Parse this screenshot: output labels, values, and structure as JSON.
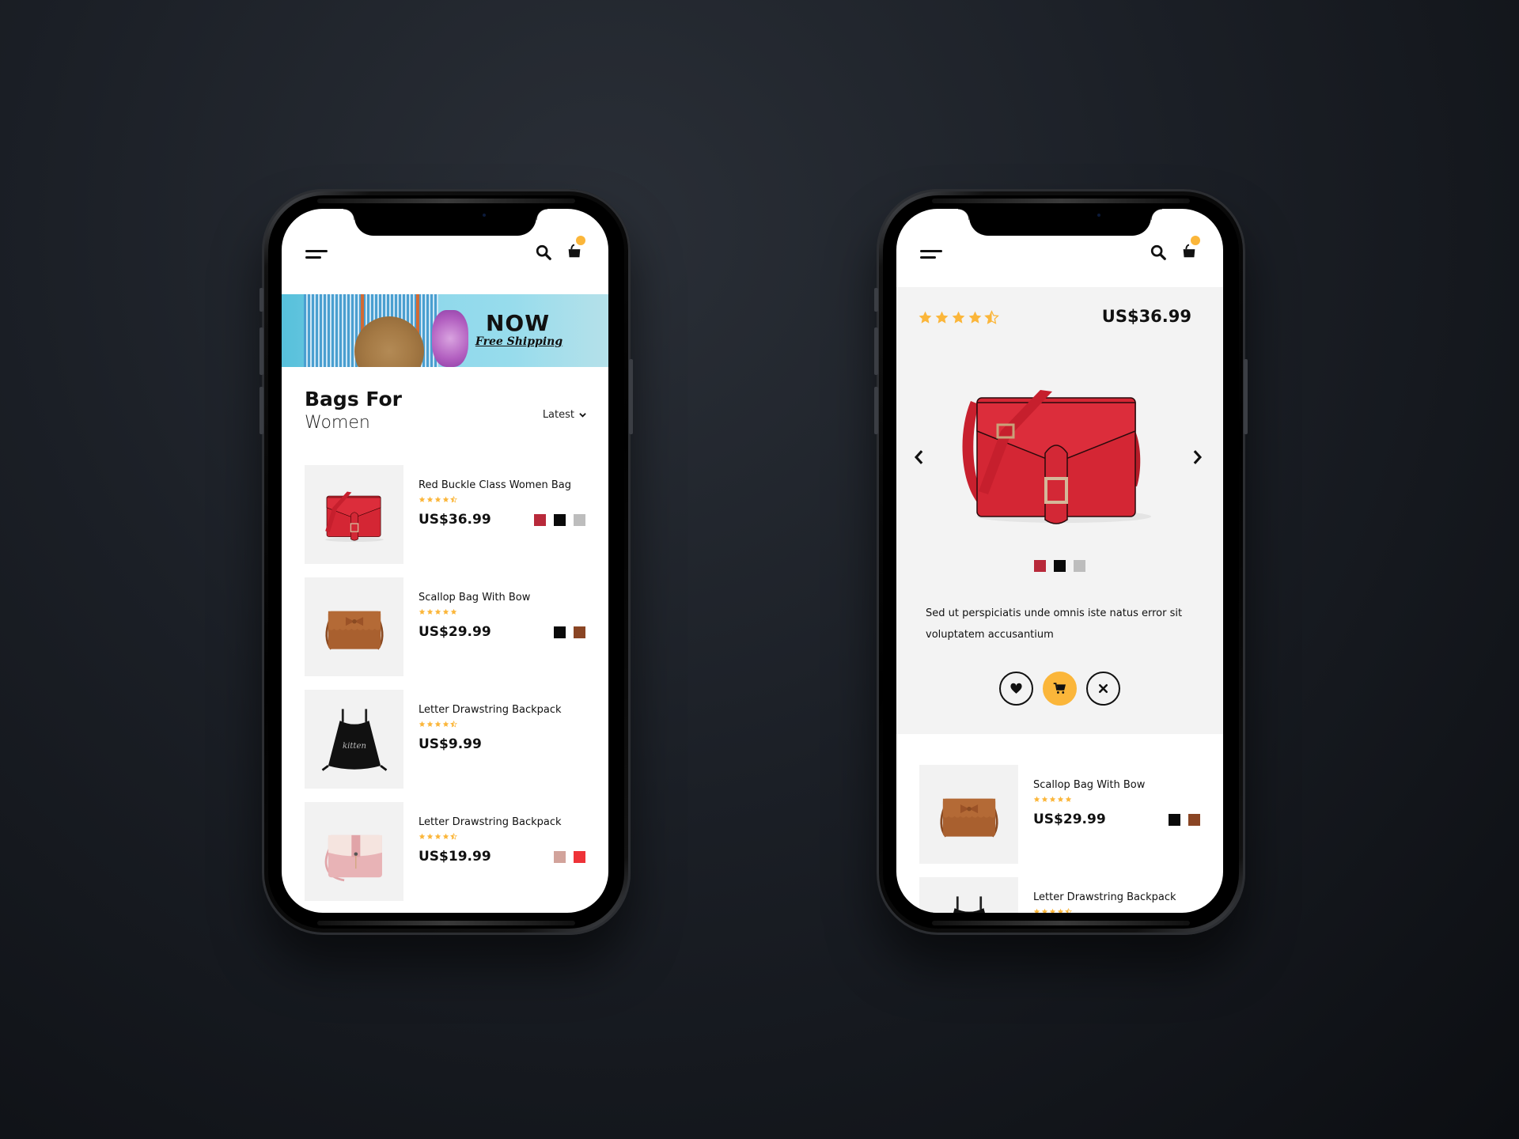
{
  "colors": {
    "accent": "#fbb63a",
    "star": "#fbb63a",
    "text": "#111111",
    "panel": "#f3f3f3"
  },
  "icons": {
    "menu": "hamburger-menu-icon",
    "search": "search-icon",
    "cart": "shopping-bag-icon",
    "prev": "chevron-left-icon",
    "next": "chevron-right-icon",
    "wishlist": "heart-icon",
    "add_to_cart": "cart-icon",
    "dismiss": "close-icon"
  },
  "listing_screen": {
    "banner": {
      "headline": "NOW",
      "subline": "Free Shipping"
    },
    "title_line1": "Bags For",
    "title_line2": "Women",
    "sort": {
      "selected": "Latest"
    },
    "products": [
      {
        "name": "Red Buckle Class Women Bag",
        "rating": 4.5,
        "price": "US$36.99",
        "swatches": [
          "#b8293a",
          "#0a0a0a",
          "#bdbdbd"
        ],
        "image": "red-bag"
      },
      {
        "name": "Scallop Bag With Bow",
        "rating": 5,
        "price": "US$29.99",
        "swatches": [
          "#0a0a0a",
          "#8a4524"
        ],
        "image": "brown-bag"
      },
      {
        "name": "Letter Drawstring Backpack",
        "rating": 4.5,
        "price": "US$9.99",
        "swatches": [],
        "image": "black-backpack"
      },
      {
        "name": "Letter Drawstring Backpack",
        "rating": 4.5,
        "price": "US$19.99",
        "swatches": [
          "#d2a39b",
          "#ee3338"
        ],
        "image": "pink-bag"
      }
    ]
  },
  "detail_screen": {
    "rating": 4.5,
    "price": "US$36.99",
    "swatches": [
      "#b8293a",
      "#0a0a0a",
      "#bdbdbd"
    ],
    "description": "Sed ut perspiciatis unde omnis iste natus error sit voluptatem accusantium",
    "related": [
      {
        "name": "Scallop Bag With Bow",
        "rating": 5,
        "price": "US$29.99",
        "swatches": [
          "#0a0a0a",
          "#8a4524"
        ],
        "image": "brown-bag"
      },
      {
        "name": "Letter Drawstring Backpack",
        "rating": 4.5,
        "price": "",
        "swatches": [],
        "image": "black-backpack"
      }
    ]
  }
}
